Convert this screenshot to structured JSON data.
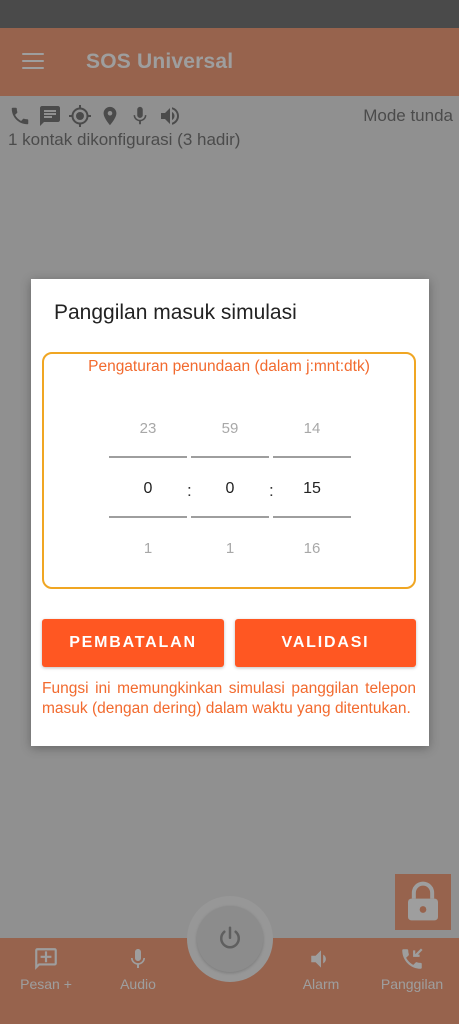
{
  "app": {
    "title": "SOS Universal"
  },
  "info": {
    "mode": "Mode tunda",
    "contacts": "1 kontak dikonfigurasi (3 hadir)",
    "icons": [
      "phone-icon",
      "message-icon",
      "gps-target-icon",
      "location-pin-icon",
      "microphone-icon",
      "volume-icon"
    ]
  },
  "dialog": {
    "title": "Panggilan masuk simulasi",
    "delay_label": "Pengaturan penundaan (dalam j:mnt:dtk)",
    "picker": {
      "hours": {
        "prev": "23",
        "value": "0",
        "next": "1"
      },
      "minutes": {
        "prev": "59",
        "value": "0",
        "next": "1"
      },
      "seconds": {
        "prev": "14",
        "value": "15",
        "next": "16"
      },
      "separator": ":"
    },
    "cancel_label": "PEMBATALAN",
    "ok_label": "VALIDASI",
    "info": "Fungsi ini memungkinkan simulasi panggilan telepon masuk (dengan dering) dalam waktu yang ditentukan."
  },
  "bottom_nav": {
    "message_plus": "Pesan +",
    "audio": "Audio",
    "alarm": "Alarm",
    "calls": "Panggilan"
  },
  "colors": {
    "primary": "#f4a07c",
    "accent": "#ff5722",
    "picker_border": "#f0a623",
    "info_text": "#f26a2e"
  }
}
